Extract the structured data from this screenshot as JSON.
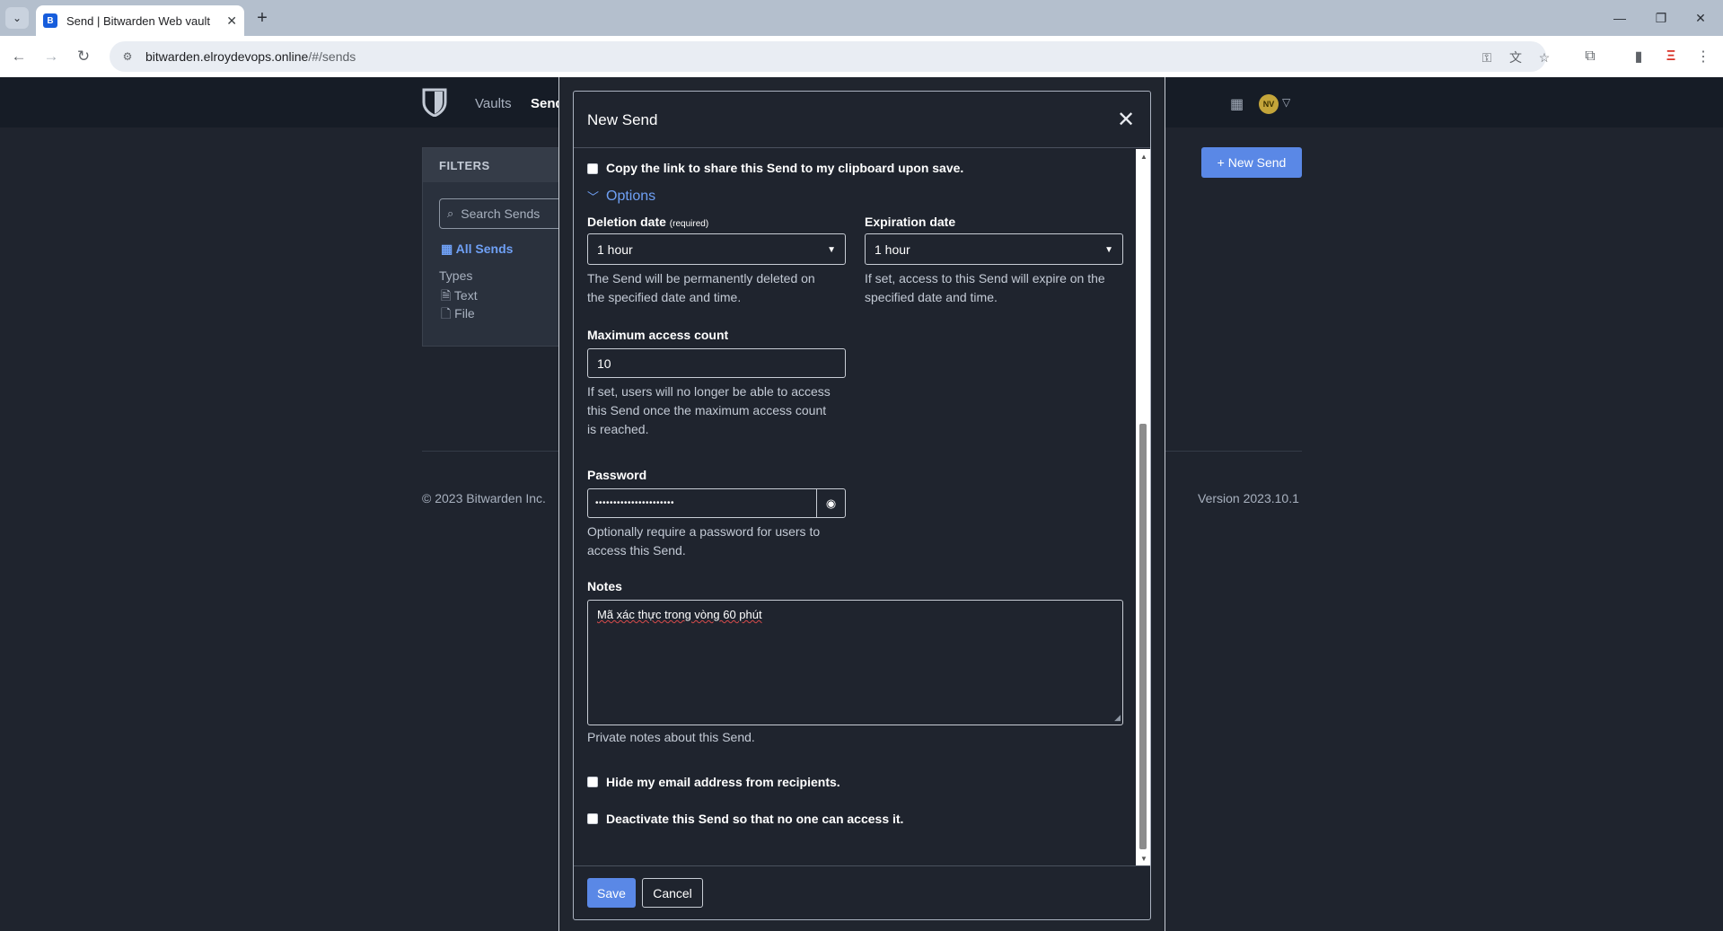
{
  "browser": {
    "tab_title": "Send | Bitwarden Web vault",
    "favicon": "B",
    "url_host": "bitwarden.elroydevops.online",
    "url_path": "/#/sends"
  },
  "app": {
    "nav": {
      "vaults": "Vaults",
      "send": "Send"
    },
    "avatar_initials": "NV",
    "filters": {
      "header": "FILTERS",
      "search_placeholder": "Search Sends",
      "all": "All Sends",
      "types_label": "Types",
      "text": "Text",
      "file": "File"
    },
    "new_send_button": "New Send",
    "copyright": "© 2023 Bitwarden Inc.",
    "version": "Version 2023.10.1",
    "accent_color": "#5a88e6"
  },
  "modal": {
    "title": "New Send",
    "copy_link_label": "Copy the link to share this Send to my clipboard upon save.",
    "options_label": "Options",
    "deletion": {
      "label": "Deletion date",
      "required": "(required)",
      "value": "1 hour",
      "help_line1": "The Send will be permanently deleted on",
      "help_line2": "the specified date and time."
    },
    "expiration": {
      "label": "Expiration date",
      "value": "1 hour",
      "help_line1": "If set, access to this Send will expire on the",
      "help_line2": "specified date and time."
    },
    "max_access": {
      "label": "Maximum access count",
      "value": "10",
      "help_line1": "If set, users will no longer be able to access",
      "help_line2": "this Send once the maximum access count",
      "help_line3": "is reached."
    },
    "password": {
      "label": "Password",
      "value": "••••••••••••••••••••••",
      "help_line1": "Optionally require a password for users to",
      "help_line2": "access this Send."
    },
    "notes": {
      "label": "Notes",
      "value": "Mã xác thực trong vòng 60 phút",
      "help": "Private notes about this Send."
    },
    "hide_email_label": "Hide my email address from recipients.",
    "deactivate_label": "Deactivate this Send so that no one can access it.",
    "save_label": "Save",
    "cancel_label": "Cancel"
  }
}
